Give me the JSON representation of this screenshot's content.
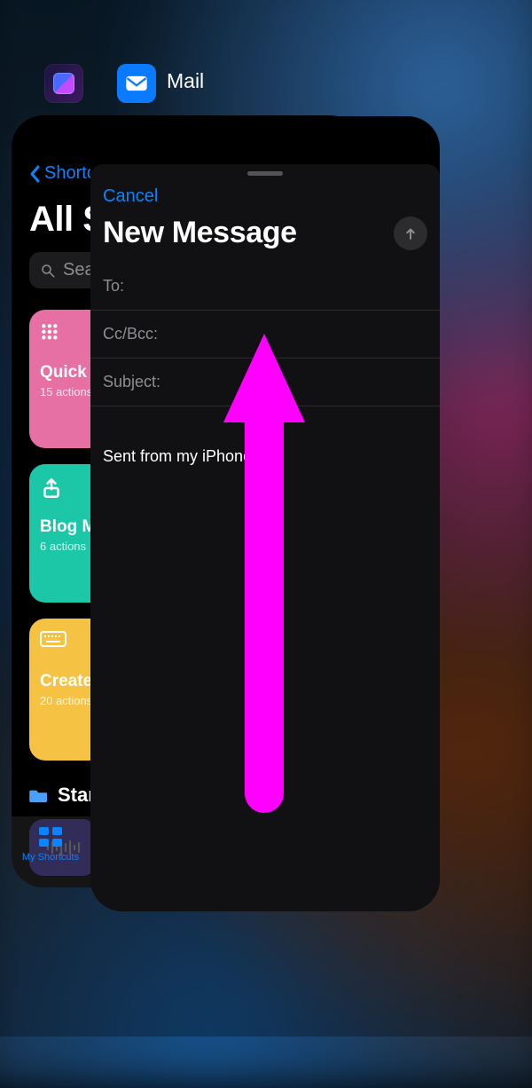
{
  "apps": {
    "shortcuts_icon_name": "shortcuts-app-icon",
    "mail_icon_name": "mail-app-icon",
    "mail_label": "Mail"
  },
  "shortcuts_card": {
    "back_label": "Shortcuts",
    "title": "All Shortcuts",
    "search_placeholder": "Search",
    "tiles": [
      {
        "title": "Quick screenshot",
        "subtitle": "15 actions"
      },
      {
        "title": "Blog Media Upload",
        "subtitle": "6 actions"
      },
      {
        "title": "Create Note",
        "subtitle": "20 actions"
      }
    ],
    "folder_label": "Starred",
    "tab_label": "My Shortcuts"
  },
  "mail_compose": {
    "cancel": "Cancel",
    "title": "New Message",
    "to_label": "To:",
    "ccbcc_label": "Cc/Bcc:",
    "subject_label": "Subject:",
    "body_signature": "Sent from my iPhone"
  },
  "annotation": {
    "magenta_arrow": "swipe-up-gesture-annotation"
  }
}
